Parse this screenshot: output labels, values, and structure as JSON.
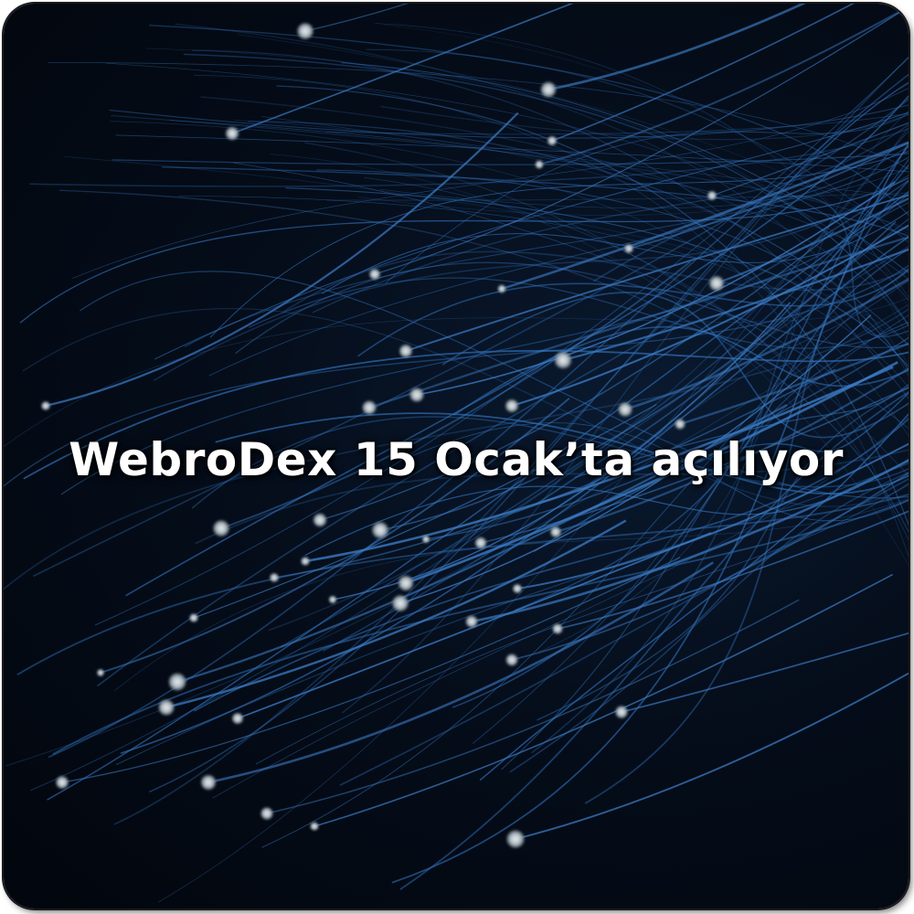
{
  "headline": {
    "text": "WebroDex 15 Ocak’ta açılıyor"
  },
  "colors": {
    "background": "#03080f",
    "fiber": "#2f6fb8",
    "fiber_tip": "#c9d2d8",
    "text": "#ffffff"
  },
  "image": {
    "description_icon": "fiber-optic-strands-image"
  }
}
